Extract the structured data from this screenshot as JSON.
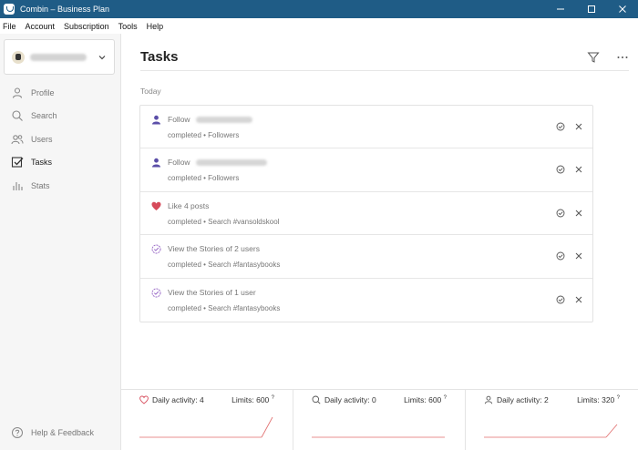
{
  "window": {
    "title": "Combin – Business Plan"
  },
  "menu": [
    "File",
    "Account",
    "Subscription",
    "Tools",
    "Help"
  ],
  "sidebar": {
    "nav": [
      {
        "label": "Profile",
        "icon": "person-icon"
      },
      {
        "label": "Search",
        "icon": "search-icon"
      },
      {
        "label": "Users",
        "icon": "users-icon"
      },
      {
        "label": "Tasks",
        "icon": "tasks-icon",
        "active": true
      },
      {
        "label": "Stats",
        "icon": "stats-icon"
      }
    ],
    "help_label": "Help & Feedback"
  },
  "main": {
    "title": "Tasks",
    "section": "Today",
    "tasks": [
      {
        "icon": "follow-icon",
        "text": "Follow",
        "blurred_target": true,
        "status": "completed • Followers"
      },
      {
        "icon": "follow-icon",
        "text": "Follow",
        "blurred_target": true,
        "status": "completed • Followers"
      },
      {
        "icon": "heart-icon",
        "text": "Like 4 posts",
        "status": "completed • Search #vansoldskool"
      },
      {
        "icon": "stories-icon",
        "text": "View the Stories of 2 users",
        "status": "completed • Search #fantasybooks"
      },
      {
        "icon": "stories-icon",
        "text": "View the Stories of 1 user",
        "status": "completed • Search #fantasybooks"
      }
    ]
  },
  "footer": {
    "panels": [
      {
        "icon": "heart-outline-icon",
        "activity": "Daily activity: 4",
        "limits": "Limits: 600",
        "limits_mark": "?"
      },
      {
        "icon": "search-icon",
        "activity": "Daily activity: 0",
        "limits": "Limits: 600",
        "limits_mark": "?"
      },
      {
        "icon": "person-icon",
        "activity": "Daily activity: 2",
        "limits": "Limits: 320",
        "limits_mark": "?"
      }
    ]
  },
  "colors": {
    "titlebar": "#1f5c86",
    "follow_icon": "#5b4ea8",
    "heart": "#d64a5a",
    "stories": "#9a6bc7",
    "spark": "#e06b6b"
  }
}
